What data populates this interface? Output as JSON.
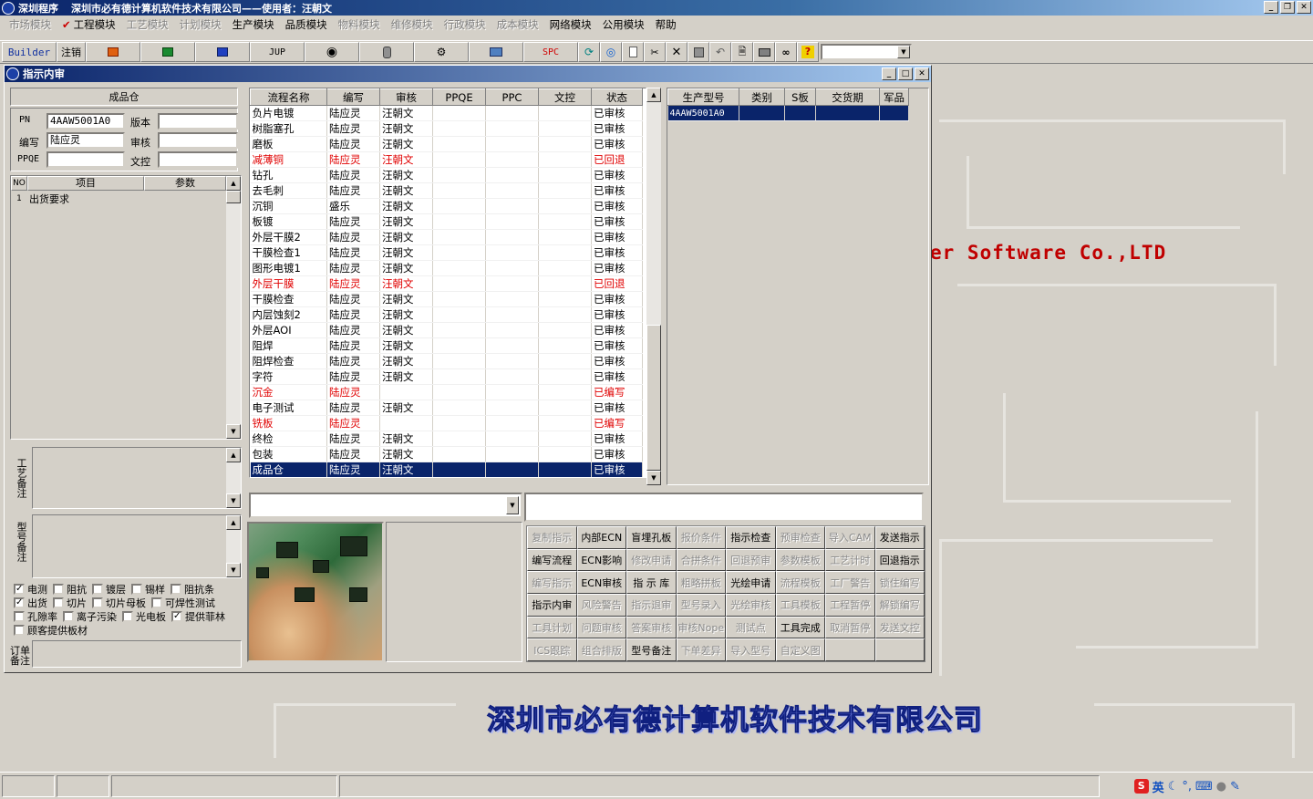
{
  "app": {
    "title_left": "深圳程序",
    "title_main": "深圳市必有德计算机软件技术有限公司——使用者：汪朝文"
  },
  "menu": [
    {
      "label": "市场模块",
      "enabled": false
    },
    {
      "label": "工程模块",
      "enabled": true,
      "checked": true
    },
    {
      "label": "工艺模块",
      "enabled": false
    },
    {
      "label": "计划模块",
      "enabled": false
    },
    {
      "label": "生产模块",
      "enabled": true
    },
    {
      "label": "品质模块",
      "enabled": true
    },
    {
      "label": "物料模块",
      "enabled": false
    },
    {
      "label": "维修模块",
      "enabled": false
    },
    {
      "label": "行政模块",
      "enabled": false
    },
    {
      "label": "成本模块",
      "enabled": false
    },
    {
      "label": "网络模块",
      "enabled": true
    },
    {
      "label": "公用模块",
      "enabled": true
    },
    {
      "label": "帮助",
      "enabled": true
    }
  ],
  "toolbar": {
    "builder": "Builder",
    "logout": "注销",
    "jup": "JUP",
    "spc": "SPC"
  },
  "child": {
    "title": "指示内审"
  },
  "left": {
    "group_title": "成品仓",
    "pn_label": "PN",
    "pn_value": "4AAW5001A0",
    "version_label": "版本",
    "version_value": "",
    "author_label": "编写",
    "author_value": "陆应灵",
    "review_label": "审核",
    "review_value": "",
    "ppqe_label": "PPQE",
    "ppqe_value": "",
    "doc_label": "文控",
    "doc_value": "",
    "params_headers": [
      "NO",
      "项目",
      "参数"
    ],
    "params_rows": [
      {
        "no": "1",
        "item": "出货要求",
        "param": ""
      }
    ],
    "memo1_label": "工艺备注",
    "memo2_label": "型号备注",
    "order_label": "订单备注",
    "checkboxes": [
      [
        {
          "label": "电测",
          "checked": true
        },
        {
          "label": "阻抗",
          "checked": false
        },
        {
          "label": "镀层",
          "checked": false
        },
        {
          "label": "锡样",
          "checked": false
        },
        {
          "label": "阻抗条",
          "checked": false
        }
      ],
      [
        {
          "label": "出货",
          "checked": true
        },
        {
          "label": "切片",
          "checked": false
        },
        {
          "label": "切片母板",
          "checked": false
        },
        {
          "label": "可焊性测试",
          "checked": false
        }
      ],
      [
        {
          "label": "孔隙率",
          "checked": false
        },
        {
          "label": "离子污染",
          "checked": false
        },
        {
          "label": "光电板",
          "checked": false
        },
        {
          "label": "提供菲林",
          "checked": true
        }
      ],
      [
        {
          "label": "顾客提供板材",
          "checked": false
        }
      ]
    ]
  },
  "process": {
    "headers": [
      "流程名称",
      "编写",
      "审核",
      "PPQE",
      "PPC",
      "文控",
      "状态"
    ],
    "rows": [
      {
        "name": "负片电镀",
        "author": "陆应灵",
        "reviewer": "汪朝文",
        "ppqe": "",
        "ppc": "",
        "doc": "",
        "status": "已审核",
        "red": false
      },
      {
        "name": "树脂塞孔",
        "author": "陆应灵",
        "reviewer": "汪朝文",
        "ppqe": "",
        "ppc": "",
        "doc": "",
        "status": "已审核",
        "red": false
      },
      {
        "name": "磨板",
        "author": "陆应灵",
        "reviewer": "汪朝文",
        "ppqe": "",
        "ppc": "",
        "doc": "",
        "status": "已审核",
        "red": false
      },
      {
        "name": "减薄铜",
        "author": "陆应灵",
        "reviewer": "汪朝文",
        "ppqe": "",
        "ppc": "",
        "doc": "",
        "status": "已回退",
        "red": true
      },
      {
        "name": "钻孔",
        "author": "陆应灵",
        "reviewer": "汪朝文",
        "ppqe": "",
        "ppc": "",
        "doc": "",
        "status": "已审核",
        "red": false
      },
      {
        "name": "去毛刺",
        "author": "陆应灵",
        "reviewer": "汪朝文",
        "ppqe": "",
        "ppc": "",
        "doc": "",
        "status": "已审核",
        "red": false
      },
      {
        "name": "沉铜",
        "author": "盛乐",
        "reviewer": "汪朝文",
        "ppqe": "",
        "ppc": "",
        "doc": "",
        "status": "已审核",
        "red": false
      },
      {
        "name": "板镀",
        "author": "陆应灵",
        "reviewer": "汪朝文",
        "ppqe": "",
        "ppc": "",
        "doc": "",
        "status": "已审核",
        "red": false
      },
      {
        "name": "外层干膜2",
        "author": "陆应灵",
        "reviewer": "汪朝文",
        "ppqe": "",
        "ppc": "",
        "doc": "",
        "status": "已审核",
        "red": false
      },
      {
        "name": "干膜检查1",
        "author": "陆应灵",
        "reviewer": "汪朝文",
        "ppqe": "",
        "ppc": "",
        "doc": "",
        "status": "已审核",
        "red": false
      },
      {
        "name": "图形电镀1",
        "author": "陆应灵",
        "reviewer": "汪朝文",
        "ppqe": "",
        "ppc": "",
        "doc": "",
        "status": "已审核",
        "red": false
      },
      {
        "name": "外层干膜",
        "author": "陆应灵",
        "reviewer": "汪朝文",
        "ppqe": "",
        "ppc": "",
        "doc": "",
        "status": "已回退",
        "red": true
      },
      {
        "name": "干膜检查",
        "author": "陆应灵",
        "reviewer": "汪朝文",
        "ppqe": "",
        "ppc": "",
        "doc": "",
        "status": "已审核",
        "red": false
      },
      {
        "name": "内层蚀刻2",
        "author": "陆应灵",
        "reviewer": "汪朝文",
        "ppqe": "",
        "ppc": "",
        "doc": "",
        "status": "已审核",
        "red": false
      },
      {
        "name": "外层AOI",
        "author": "陆应灵",
        "reviewer": "汪朝文",
        "ppqe": "",
        "ppc": "",
        "doc": "",
        "status": "已审核",
        "red": false
      },
      {
        "name": "阻焊",
        "author": "陆应灵",
        "reviewer": "汪朝文",
        "ppqe": "",
        "ppc": "",
        "doc": "",
        "status": "已审核",
        "red": false
      },
      {
        "name": "阻焊检查",
        "author": "陆应灵",
        "reviewer": "汪朝文",
        "ppqe": "",
        "ppc": "",
        "doc": "",
        "status": "已审核",
        "red": false
      },
      {
        "name": "字符",
        "author": "陆应灵",
        "reviewer": "汪朝文",
        "ppqe": "",
        "ppc": "",
        "doc": "",
        "status": "已审核",
        "red": false
      },
      {
        "name": "沉金",
        "author": "陆应灵",
        "reviewer": "",
        "ppqe": "",
        "ppc": "",
        "doc": "",
        "status": "已编写",
        "red": true
      },
      {
        "name": "电子测试",
        "author": "陆应灵",
        "reviewer": "汪朝文",
        "ppqe": "",
        "ppc": "",
        "doc": "",
        "status": "已审核",
        "red": false
      },
      {
        "name": "铣板",
        "author": "陆应灵",
        "reviewer": "",
        "ppqe": "",
        "ppc": "",
        "doc": "",
        "status": "已编写",
        "red": true
      },
      {
        "name": "终检",
        "author": "陆应灵",
        "reviewer": "汪朝文",
        "ppqe": "",
        "ppc": "",
        "doc": "",
        "status": "已审核",
        "red": false
      },
      {
        "name": "包装",
        "author": "陆应灵",
        "reviewer": "汪朝文",
        "ppqe": "",
        "ppc": "",
        "doc": "",
        "status": "已审核",
        "red": false
      },
      {
        "name": "成品仓",
        "author": "陆应灵",
        "reviewer": "汪朝文",
        "ppqe": "",
        "ppc": "",
        "doc": "",
        "status": "已审核",
        "red": false,
        "selected": true
      }
    ]
  },
  "models": {
    "headers": [
      "生产型号",
      "类别",
      "S板",
      "交货期",
      "军品"
    ],
    "rows": [
      {
        "model": "4AAW5001A0",
        "type": "",
        "s": "",
        "delivery": "",
        "military": "",
        "selected": true
      }
    ]
  },
  "buttons": [
    {
      "label": "复制指示",
      "enabled": false
    },
    {
      "label": "内部ECN",
      "enabled": true
    },
    {
      "label": "盲埋孔板",
      "enabled": true
    },
    {
      "label": "报价条件",
      "enabled": false
    },
    {
      "label": "指示检查",
      "enabled": true
    },
    {
      "label": "预审检查",
      "enabled": false
    },
    {
      "label": "导入CAM",
      "enabled": false
    },
    {
      "label": "发送指示",
      "enabled": true
    },
    {
      "label": "编写流程",
      "enabled": true
    },
    {
      "label": "ECN影响",
      "enabled": true
    },
    {
      "label": "修改申请",
      "enabled": false
    },
    {
      "label": "合拼条件",
      "enabled": false
    },
    {
      "label": "回退预审",
      "enabled": false
    },
    {
      "label": "参数模板",
      "enabled": false
    },
    {
      "label": "工艺计时",
      "enabled": false
    },
    {
      "label": "回退指示",
      "enabled": true
    },
    {
      "label": "编写指示",
      "enabled": false
    },
    {
      "label": "ECN审核",
      "enabled": true
    },
    {
      "label": "指 示 库",
      "enabled": true
    },
    {
      "label": "粗略拼板",
      "enabled": false
    },
    {
      "label": "光绘申请",
      "enabled": true
    },
    {
      "label": "流程模板",
      "enabled": false
    },
    {
      "label": "工厂警告",
      "enabled": false
    },
    {
      "label": "锁住编写",
      "enabled": false
    },
    {
      "label": "指示内审",
      "enabled": true
    },
    {
      "label": "风险警告",
      "enabled": false
    },
    {
      "label": "指示退审",
      "enabled": false
    },
    {
      "label": "型号录入",
      "enabled": false
    },
    {
      "label": "光绘审核",
      "enabled": false
    },
    {
      "label": "工具模板",
      "enabled": false
    },
    {
      "label": "工程暂停",
      "enabled": false
    },
    {
      "label": "解锁编写",
      "enabled": false
    },
    {
      "label": "工具计划",
      "enabled": false
    },
    {
      "label": "问题审核",
      "enabled": false
    },
    {
      "label": "答案审核",
      "enabled": false
    },
    {
      "label": "审核Nope",
      "enabled": false
    },
    {
      "label": "测试点",
      "enabled": false
    },
    {
      "label": "工具完成",
      "enabled": true
    },
    {
      "label": "取消暂停",
      "enabled": false
    },
    {
      "label": "发送文控",
      "enabled": false
    },
    {
      "label": "ICS跟踪",
      "enabled": false
    },
    {
      "label": "组合排版",
      "enabled": false
    },
    {
      "label": "型号备注",
      "enabled": true
    },
    {
      "label": "下单差异",
      "enabled": false
    },
    {
      "label": "导入型号",
      "enabled": false
    },
    {
      "label": "自定义图",
      "enabled": false
    },
    {
      "label": "",
      "enabled": false
    },
    {
      "label": "",
      "enabled": false
    }
  ],
  "background": {
    "company_en": "er Software Co.,LTD",
    "company_cn": "深圳市必有德计算机软件技术有限公司"
  },
  "statusbar": {
    "ime_lang": "英"
  }
}
